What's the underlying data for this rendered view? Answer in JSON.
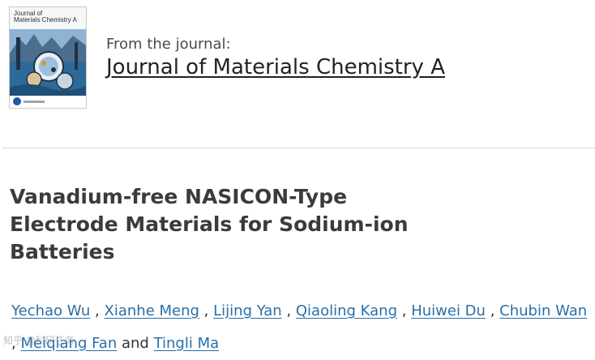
{
  "cover": {
    "title_line1": "Journal of",
    "title_line2": "Materials Chemistry A",
    "colors": {
      "sky": "#cfe0ee",
      "sea": "#2d6a9a",
      "accent": "#e0902a",
      "dark": "#1f3346"
    }
  },
  "journal": {
    "from_label": "From the journal:",
    "name": "Journal of Materials Chemistry A"
  },
  "article": {
    "title": "Vanadium-free NASICON-Type Electrode Materials for Sodium-ion Batteries"
  },
  "authors": {
    "list": [
      "Yechao Wu",
      "Xianhe Meng",
      "Lijing Yan",
      "Qiaoling Kang",
      "Huiwei Du",
      "Chubin Wan",
      "Meiqiang Fan",
      "Tingli Ma"
    ],
    "separator": ",",
    "conjunction": "and"
  },
  "watermark": "知乎 @科研任务"
}
